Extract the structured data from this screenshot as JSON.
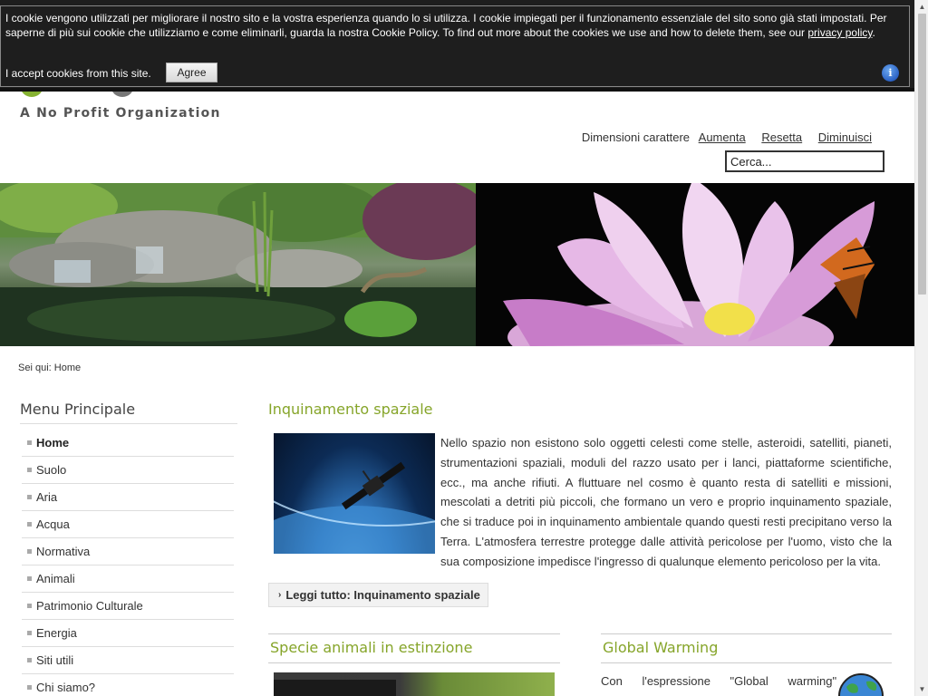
{
  "cookie_bar": {
    "message_prefix": "I cookie vengono utilizzati per migliorare il nostro sito e la vostra esperienza quando lo si utilizza. I cookie impiegati per il funzionamento essenziale del sito sono già stati impostati. Per saperne di più sui cookie che utilizziamo e come eliminarli, guarda la nostra Cookie Policy. To find out more about the cookies we use and how to delete them, see our ",
    "privacy_link": "privacy policy",
    "message_suffix": ".",
    "accept_text": "I accept cookies from this site.",
    "agree_label": "Agree",
    "info_label": "i"
  },
  "header": {
    "tagline": "A No Profit Organization",
    "font_size_label": "Dimensioni carattere",
    "font_links": [
      "Aumenta",
      "Resetta",
      "Diminuisci"
    ],
    "search_placeholder": "Cerca..."
  },
  "breadcrumb": {
    "label": "Sei qui:",
    "current": "Home"
  },
  "sidebar": {
    "title": "Menu Principale",
    "items": [
      {
        "label": "Home",
        "active": true
      },
      {
        "label": "Suolo"
      },
      {
        "label": "Aria"
      },
      {
        "label": "Acqua"
      },
      {
        "label": "Normativa"
      },
      {
        "label": "Animali"
      },
      {
        "label": "Patrimonio Culturale"
      },
      {
        "label": "Energia"
      },
      {
        "label": "Siti utili"
      },
      {
        "label": "Chi siamo?"
      }
    ]
  },
  "main": {
    "article_title": "Inquinamento spaziale",
    "article_text": "Nello spazio non esistono solo oggetti celesti come stelle, asteroidi, satelliti, pianeti, strumentazioni spaziali, moduli del razzo usato per i lanci, piattaforme scientifiche, ecc., ma anche rifiuti. A fluttuare nel cosmo è quanto resta di satelliti e missioni, mescolati a detriti più piccoli, che formano un vero e proprio inquinamento spaziale, che si traduce poi in inquinamento ambientale quando questi resti precipitano verso la Terra. L'atmosfera terrestre protegge dalle attività pericolose per l'uomo, visto che la sua composizione impedisce l'ingresso di qualunque elemento pericoloso per la vita.",
    "read_more": "Leggi tutto: Inquinamento spaziale",
    "col1_title": "Specie animali in estinzione",
    "col2_title": "Global Warming",
    "col2_text": "Con l'espressione \"Global warming\""
  },
  "colors": {
    "accent_green": "#86a52a",
    "cookie_bg": "#1e1e1e"
  }
}
